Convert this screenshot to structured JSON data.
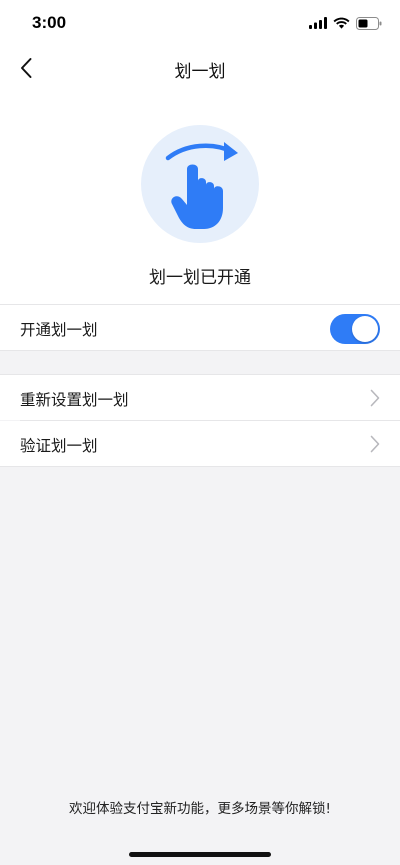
{
  "status_bar": {
    "time": "3:00",
    "icons": [
      "cellular-signal-icon",
      "wifi-icon",
      "battery-icon"
    ]
  },
  "nav": {
    "title": "划一划",
    "back_icon": "chevron-left-icon"
  },
  "hero": {
    "icon": "swipe-gesture-icon",
    "status_text": "划一划已开通"
  },
  "settings": {
    "enable_row": {
      "label": "开通划一划",
      "toggle_on": true
    },
    "items": [
      {
        "label": "重新设置划一划",
        "icon": "chevron-right-icon"
      },
      {
        "label": "验证划一划",
        "icon": "chevron-right-icon"
      }
    ]
  },
  "footer": {
    "text": "欢迎体验支付宝新功能，更多场景等你解锁!"
  },
  "colors": {
    "accent": "#2f7cf6",
    "hero_circle": "#e6effb",
    "background": "#f3f3f5"
  }
}
